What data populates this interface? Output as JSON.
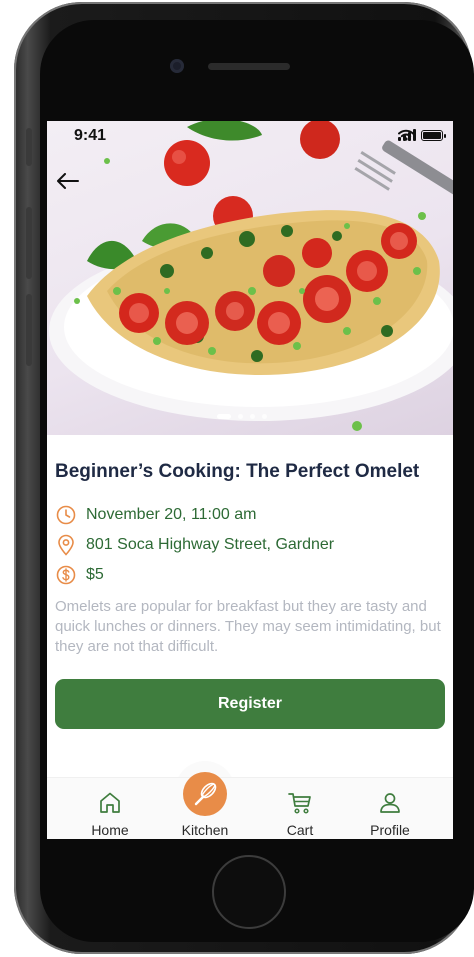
{
  "status_bar": {
    "time": "9:41"
  },
  "event": {
    "title": "Beginner’s Cooking: The Perfect Omelet",
    "date": "November 20, 11:00 am",
    "location": "801 Soca Highway Street, Gardner",
    "price": "$5",
    "description": "Omelets are popular for breakfast but they are tasty and quick lunches or dinners. They may seem intimidating, but they are not that difficult."
  },
  "hero": {
    "carousel_count": 4,
    "carousel_active_index": 0,
    "back_icon": "arrow-left-icon"
  },
  "actions": {
    "register_label": "Register"
  },
  "tabbar": {
    "items": [
      {
        "label": "Home",
        "icon": "home-icon"
      },
      {
        "label": "Kitchen",
        "icon": "whisk-icon",
        "active": true
      },
      {
        "label": "Cart",
        "icon": "cart-icon"
      },
      {
        "label": "Profile",
        "icon": "user-icon"
      }
    ]
  },
  "colors": {
    "accent_green": "#3f7d3e",
    "icon_orange": "#e88c48",
    "title_navy": "#1f2a44",
    "muted_text": "#b3b7c0"
  }
}
